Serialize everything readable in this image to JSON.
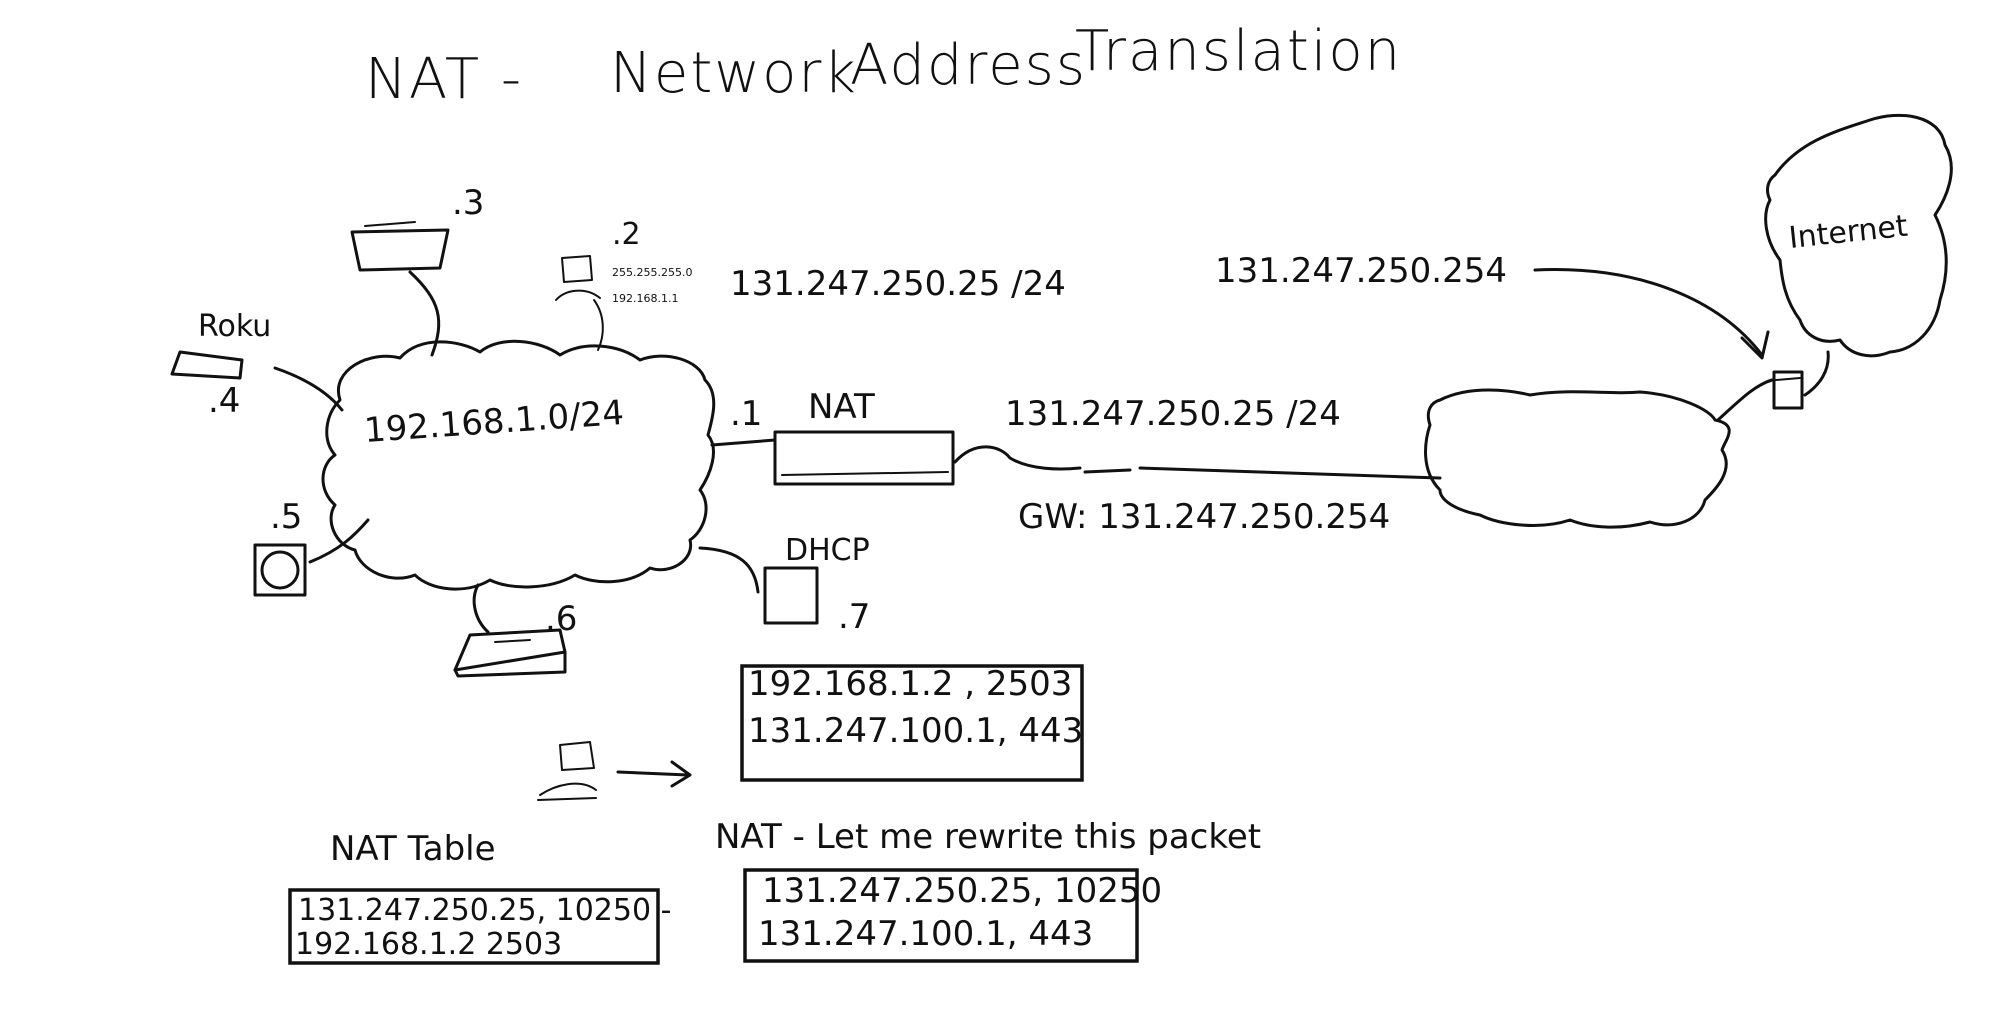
{
  "title": {
    "part1": "NAT -",
    "part2": "Network",
    "part3": "Address",
    "part4": "Translation"
  },
  "lan": {
    "subnet": "192.168.1.0/24",
    "hosts": {
      "h1": ".1",
      "h2": ".2",
      "h3": ".3",
      "h4": ".4",
      "h5": ".5",
      "h6": ".6",
      "h7": ".7"
    },
    "roku_label": "Roku",
    "dhcp_label": "DHCP",
    "host2_mask": "255.255.255.0",
    "host2_gw": "192.168.1.1",
    "host2_public_ip": "131.247.250.25 /24"
  },
  "nat_label": "NAT",
  "wan": {
    "nat_outside_ip": "131.247.250.25 /24",
    "gateway": "GW: 131.247.250.254",
    "router_ip": "131.247.250.254",
    "internet_label": "Internet"
  },
  "packet_original": {
    "line1": "192.168.1.2 ,  2503",
    "line2": "131.247.100.1,  443"
  },
  "rewrite_caption": "NAT - Let me rewrite this packet",
  "packet_rewritten": {
    "line1": "131.247.250.25,  10250",
    "line2": "131.247.100.1,  443"
  },
  "nat_table": {
    "title": "NAT  Table",
    "line1": "131.247.250.25,  10250 -",
    "line2": "192.168.1.2    2503"
  }
}
